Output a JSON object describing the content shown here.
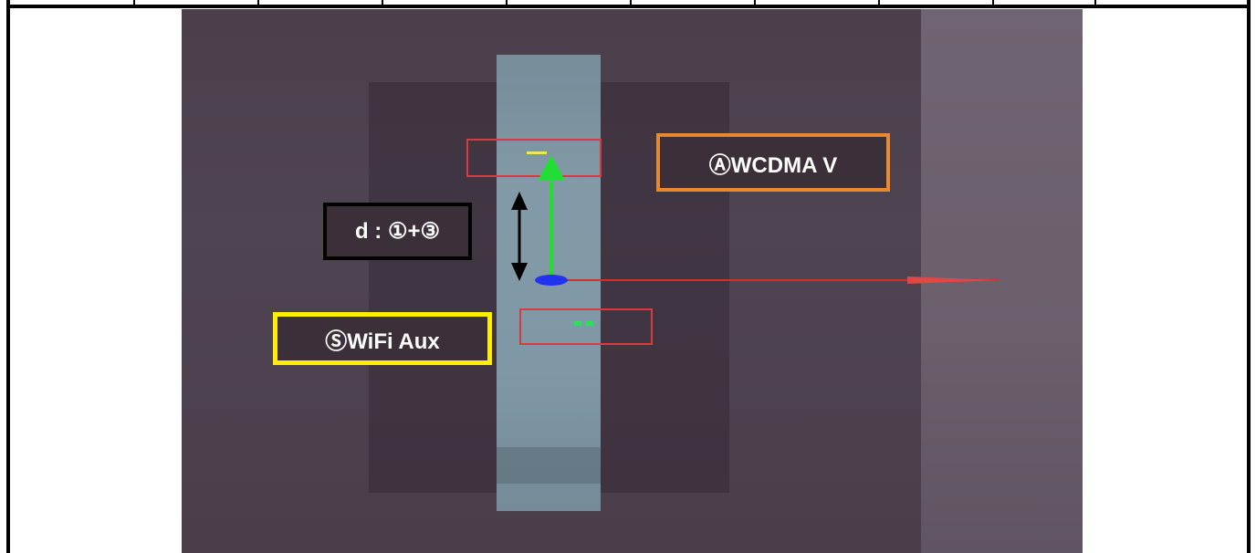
{
  "document": {
    "table": {
      "top_row_cells": [
        "",
        "",
        "",
        "",
        "",
        "",
        "",
        "",
        "",
        ""
      ]
    },
    "figure": {
      "labels": {
        "wcdma": "ⒶWCDMA V",
        "distance": "d : ①+③",
        "wifi": "ⓈWiFi Aux"
      },
      "colors": {
        "wcdma_border": "#e8892f",
        "distance_border": "#000000",
        "wifi_border": "#ffee00",
        "marker_red": "#d93a3f",
        "axis_green": "#22dd33",
        "axis_blue": "#2233ee",
        "axis_red": "#d03030"
      }
    }
  }
}
